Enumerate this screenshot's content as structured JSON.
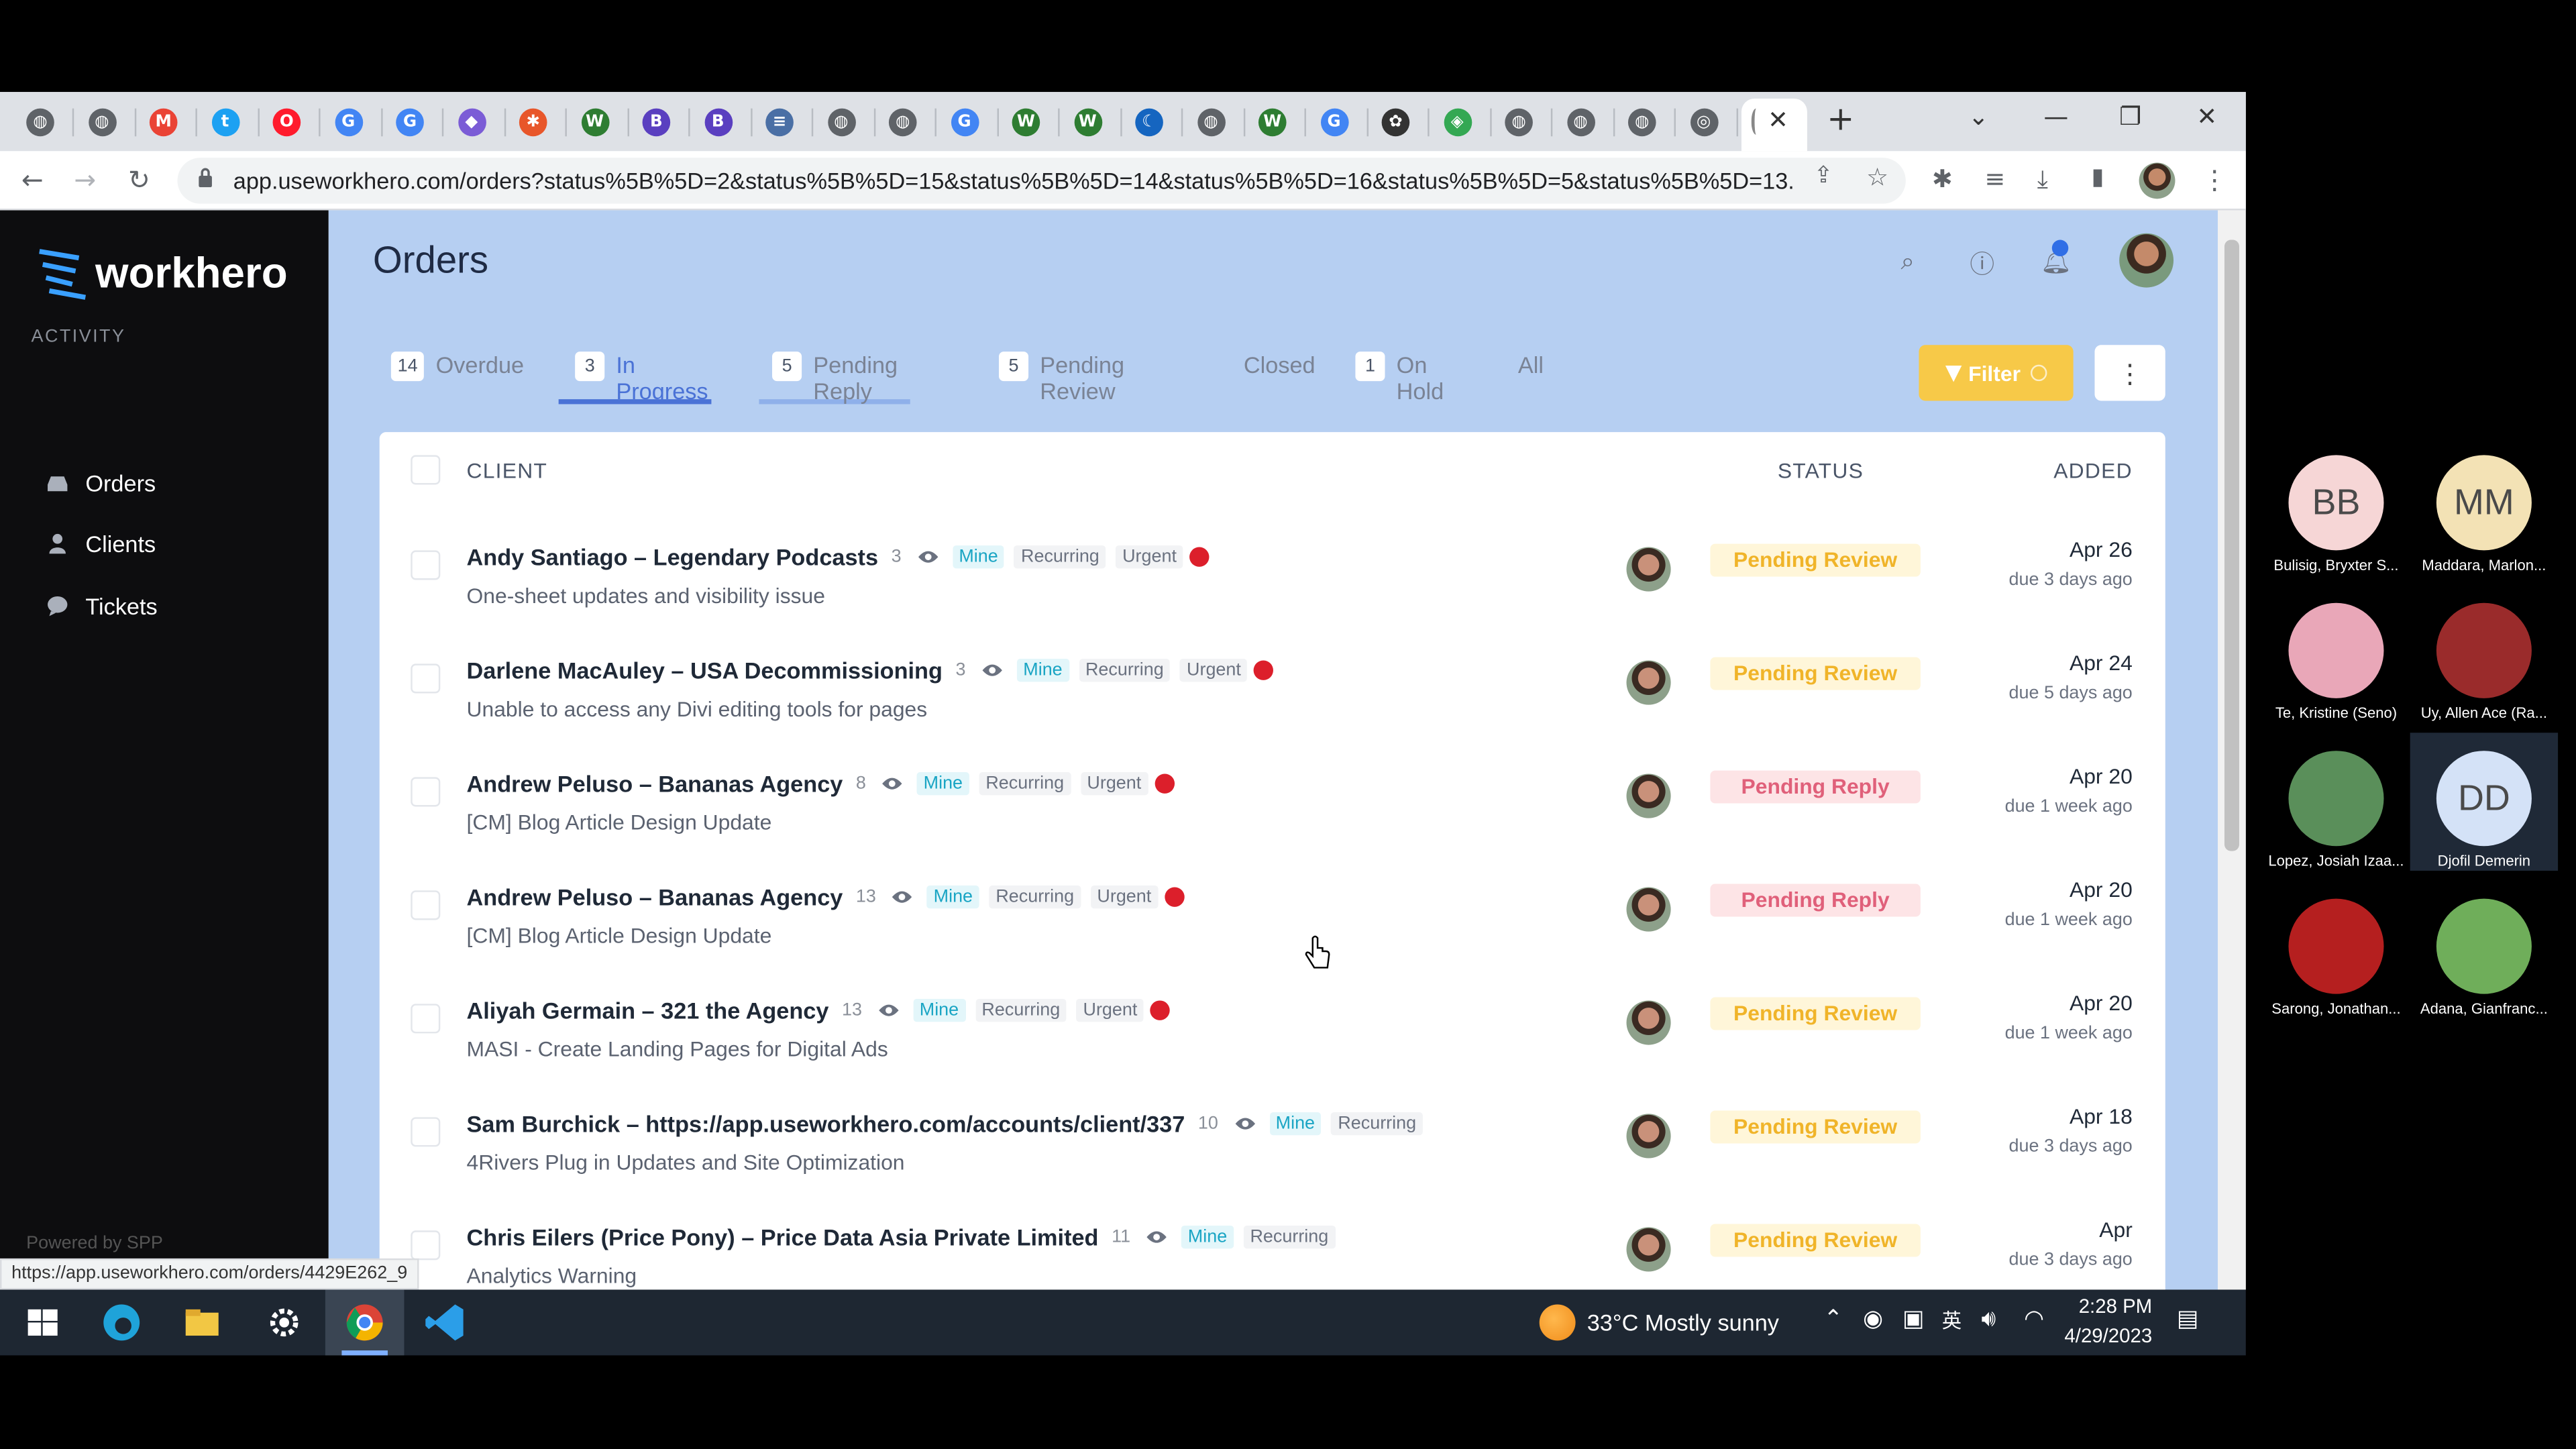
{
  "browser": {
    "url": "app.useworkhero.com/orders?status%5B%5D=2&status%5B%5D=15&status%5B%5D=14&status%5B%5D=16&status%5B%5D=5&status%5B%5D=13...",
    "status_url": "https://app.useworkhero.com/orders/4429E262_9",
    "tab_icons": [
      "globe-icon",
      "globe-icon",
      "gmail-icon",
      "twitter-icon",
      "opera-icon",
      "google-icon",
      "google-icon",
      "app-icon",
      "asterisk-icon",
      "w-icon",
      "b-icon",
      "b-icon",
      "nlm-icon",
      "globe-icon",
      "globe-icon",
      "google-icon",
      "w-icon",
      "w-icon",
      "moon-icon",
      "globe-icon",
      "w-icon",
      "google-icon",
      "paw-icon",
      "diamond-icon",
      "globe-icon",
      "globe-icon",
      "globe-icon",
      "chrome-icon"
    ],
    "new_tab": "+",
    "close": "✕"
  },
  "sidebar": {
    "brand": "workhero",
    "section": "ACTIVITY",
    "items": [
      {
        "label": "Orders",
        "icon": "inbox-icon"
      },
      {
        "label": "Clients",
        "icon": "user-icon"
      },
      {
        "label": "Tickets",
        "icon": "chat-icon"
      }
    ],
    "powered": "Powered by SPP"
  },
  "header": {
    "title": "Orders"
  },
  "tabs": [
    {
      "count": "14",
      "label": "Overdue"
    },
    {
      "count": "3",
      "label": "In Progress"
    },
    {
      "count": "5",
      "label": "Pending Reply"
    },
    {
      "count": "5",
      "label": "Pending Review"
    },
    {
      "count": "",
      "label": "Closed"
    },
    {
      "count": "1",
      "label": "On Hold"
    },
    {
      "count": "",
      "label": "All"
    }
  ],
  "filter_label": "Filter",
  "table": {
    "headers": {
      "client": "CLIENT",
      "status": "STATUS",
      "added": "ADDED"
    },
    "rows": [
      {
        "title": "Andy Santiago – Legendary Podcasts",
        "count": "3",
        "mine": "Mine",
        "recurring": "Recurring",
        "urgent": "Urgent",
        "subtitle": "One-sheet updates and visibility issue",
        "status": "Pending Review",
        "date": "Apr 26",
        "due": "due 3 days ago"
      },
      {
        "title": "Darlene MacAuley – USA Decommissioning",
        "count": "3",
        "mine": "Mine",
        "recurring": "Recurring",
        "urgent": "Urgent",
        "subtitle": "Unable to access any Divi editing tools for pages",
        "status": "Pending Review",
        "date": "Apr 24",
        "due": "due 5 days ago"
      },
      {
        "title": "Andrew Peluso – Bananas Agency",
        "count": "8",
        "mine": "Mine",
        "recurring": "Recurring",
        "urgent": "Urgent",
        "subtitle": "[CM] Blog Article Design Update",
        "status": "Pending Reply",
        "date": "Apr 20",
        "due": "due 1 week ago"
      },
      {
        "title": "Andrew Peluso – Bananas Agency",
        "count": "13",
        "mine": "Mine",
        "recurring": "Recurring",
        "urgent": "Urgent",
        "subtitle": "[CM] Blog Article Design Update",
        "status": "Pending Reply",
        "date": "Apr 20",
        "due": "due 1 week ago"
      },
      {
        "title": "Aliyah Germain – 321 the Agency",
        "count": "13",
        "mine": "Mine",
        "recurring": "Recurring",
        "urgent": "Urgent",
        "subtitle": "MASI - Create Landing Pages for Digital Ads",
        "status": "Pending Review",
        "date": "Apr 20",
        "due": "due 1 week ago"
      },
      {
        "title": "Sam Burchick – https://app.useworkhero.com/accounts/client/337",
        "count": "10",
        "mine": "Mine",
        "recurring": "Recurring",
        "urgent": "",
        "subtitle": "4Rivers Plug in Updates and Site Optimization",
        "status": "Pending Review",
        "date": "Apr 18",
        "due": "due 3 days ago"
      },
      {
        "title": "Chris Eilers (Price Pony) – Price Data Asia Private Limited",
        "count": "11",
        "mine": "Mine",
        "recurring": "Recurring",
        "urgent": "",
        "subtitle": "Analytics Warning",
        "status": "Pending Review",
        "date": "Apr",
        "due": "due 3 days ago"
      }
    ]
  },
  "taskbar": {
    "weather": "33°C  Mostly sunny",
    "time": "2:28 PM",
    "date": "4/29/2023"
  },
  "participants": [
    {
      "initials": "BB",
      "name": "Bulisig, Bryxter S...",
      "color": "#f6d6d6"
    },
    {
      "initials": "MM",
      "name": "Maddara, Marlon...",
      "color": "#f3e2b5"
    },
    {
      "initials": "",
      "name": "Te, Kristine (Seno)",
      "color": "#e9a7b8"
    },
    {
      "initials": "",
      "name": "Uy, Allen Ace (Ra...",
      "color": "#9a2b2b"
    },
    {
      "initials": "",
      "name": "Lopez, Josiah Izaa...",
      "color": "#5a8f5a"
    },
    {
      "initials": "DD",
      "name": "Djofil Demerin",
      "color": "#d4e2f7"
    },
    {
      "initials": "",
      "name": "Sarong, Jonathan...",
      "color": "#b51f1f"
    },
    {
      "initials": "",
      "name": "Adana, Gianfranc...",
      "color": "#6fae5a"
    }
  ]
}
